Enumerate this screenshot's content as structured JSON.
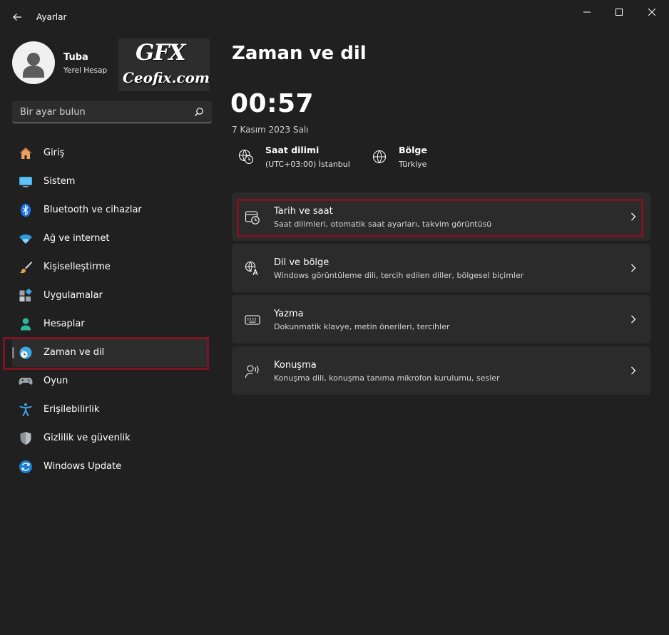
{
  "window": {
    "title": "Ayarlar"
  },
  "profile": {
    "name": "Tuba",
    "account_type": "Yerel Hesap"
  },
  "watermark": {
    "logo": "GFX",
    "site": "Ceofix.com"
  },
  "search": {
    "placeholder": "Bir ayar bulun",
    "icon": "search-icon"
  },
  "nav": [
    {
      "label": "Giriş",
      "icon": "home-icon",
      "selected": false
    },
    {
      "label": "Sistem",
      "icon": "monitor-icon",
      "selected": false
    },
    {
      "label": "Bluetooth ve cihazlar",
      "icon": "bluetooth-icon",
      "selected": false
    },
    {
      "label": "Ağ ve internet",
      "icon": "wifi-icon",
      "selected": false
    },
    {
      "label": "Kişiselleştirme",
      "icon": "brush-icon",
      "selected": false
    },
    {
      "label": "Uygulamalar",
      "icon": "apps-icon",
      "selected": false
    },
    {
      "label": "Hesaplar",
      "icon": "person-icon",
      "selected": false
    },
    {
      "label": "Zaman ve dil",
      "icon": "globe-clock-icon",
      "selected": true
    },
    {
      "label": "Oyun",
      "icon": "gamepad-icon",
      "selected": false
    },
    {
      "label": "Erişilebilirlik",
      "icon": "accessibility-icon",
      "selected": false
    },
    {
      "label": "Gizlilik ve güvenlik",
      "icon": "shield-icon",
      "selected": false
    },
    {
      "label": "Windows Update",
      "icon": "update-icon",
      "selected": false
    }
  ],
  "main": {
    "title": "Zaman ve dil",
    "time": "00:57",
    "date": "7 Kasım 2023 Salı",
    "info": [
      {
        "label": "Saat dilimi",
        "value": "(UTC+03:00) İstanbul",
        "icon": "timezone-icon"
      },
      {
        "label": "Bölge",
        "value": "Türkiye",
        "icon": "globe-icon"
      }
    ],
    "cards": [
      {
        "title": "Tarih ve saat",
        "subtitle": "Saat dilimleri, otomatik saat ayarları, takvim görüntüsü",
        "icon": "calendar-clock-icon",
        "highlighted": true
      },
      {
        "title": "Dil ve bölge",
        "subtitle": "Windows görüntüleme dili, tercih edilen diller, bölgesel biçimler",
        "icon": "language-icon",
        "highlighted": false
      },
      {
        "title": "Yazma",
        "subtitle": "Dokunmatik klavye, metin önerileri, tercihler",
        "icon": "keyboard-icon",
        "highlighted": false
      },
      {
        "title": "Konuşma",
        "subtitle": "Konuşma dili, konuşma tanıma mikrofon kurulumu, sesler",
        "icon": "speech-icon",
        "highlighted": false
      }
    ]
  },
  "colors": {
    "background": "#202020",
    "card": "#2b2b2b",
    "highlight_border": "#7d1424",
    "accent": "#0078d4"
  }
}
